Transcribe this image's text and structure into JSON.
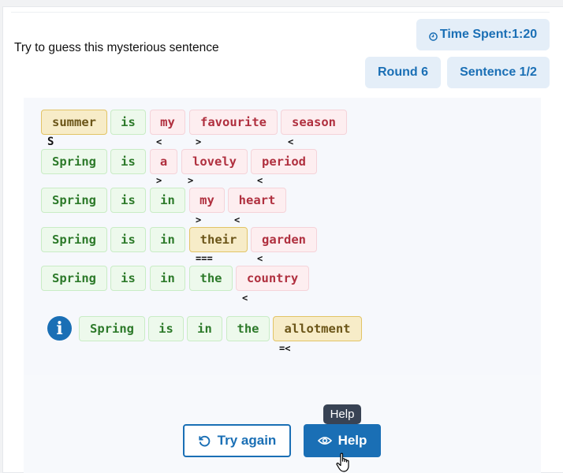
{
  "prompt": "Try to guess this mysterious sentence",
  "stats": {
    "time_spent": "Time Spent:1:20",
    "round": "Round 6",
    "sentence": "Sentence 1/2"
  },
  "rows": [
    {
      "words": [
        {
          "text": "summer",
          "state": "misplaced",
          "hint": "S"
        },
        {
          "text": "is",
          "state": "correct",
          "hint": ""
        },
        {
          "text": "my",
          "state": "wrong",
          "hint": "<"
        },
        {
          "text": "favourite",
          "state": "wrong",
          "hint": ">"
        },
        {
          "text": "season",
          "state": "wrong",
          "hint": "<"
        }
      ]
    },
    {
      "words": [
        {
          "text": "Spring",
          "state": "correct",
          "hint": ""
        },
        {
          "text": "is",
          "state": "correct",
          "hint": ""
        },
        {
          "text": "a",
          "state": "wrong",
          "hint": ">"
        },
        {
          "text": "lovely",
          "state": "wrong",
          "hint": ">"
        },
        {
          "text": "period",
          "state": "wrong",
          "hint": "<"
        }
      ]
    },
    {
      "words": [
        {
          "text": "Spring",
          "state": "correct",
          "hint": ""
        },
        {
          "text": "is",
          "state": "correct",
          "hint": ""
        },
        {
          "text": "in",
          "state": "correct",
          "hint": ""
        },
        {
          "text": "my",
          "state": "wrong",
          "hint": ">"
        },
        {
          "text": "heart",
          "state": "wrong",
          "hint": "<"
        }
      ]
    },
    {
      "words": [
        {
          "text": "Spring",
          "state": "correct",
          "hint": ""
        },
        {
          "text": "is",
          "state": "correct",
          "hint": ""
        },
        {
          "text": "in",
          "state": "correct",
          "hint": ""
        },
        {
          "text": "their",
          "state": "misplaced",
          "hint": "==="
        },
        {
          "text": "garden",
          "state": "wrong",
          "hint": "<"
        }
      ]
    },
    {
      "words": [
        {
          "text": "Spring",
          "state": "correct",
          "hint": ""
        },
        {
          "text": "is",
          "state": "correct",
          "hint": ""
        },
        {
          "text": "in",
          "state": "correct",
          "hint": ""
        },
        {
          "text": "the",
          "state": "correct",
          "hint": ""
        },
        {
          "text": "country",
          "state": "wrong",
          "hint": "<"
        }
      ]
    }
  ],
  "hint_row": {
    "icon": "info-icon",
    "icon_glyph": "i",
    "words": [
      {
        "text": "Spring",
        "state": "correct",
        "hint": ""
      },
      {
        "text": "is",
        "state": "correct",
        "hint": ""
      },
      {
        "text": "in",
        "state": "correct",
        "hint": ""
      },
      {
        "text": "the",
        "state": "correct",
        "hint": ""
      },
      {
        "text": "allotment",
        "state": "misplaced",
        "hint": "=<"
      }
    ]
  },
  "buttons": {
    "try_again": "Try again",
    "help": "Help"
  },
  "tooltip": "Help",
  "colors": {
    "primary": "#1a6fb5",
    "correct_bg": "#edf9ec",
    "correct_text": "#2d7a2a",
    "wrong_bg": "#fdeef0",
    "wrong_text": "#b0303f",
    "misplaced_bg": "#f7ecc8",
    "misplaced_text": "#6b5518"
  }
}
